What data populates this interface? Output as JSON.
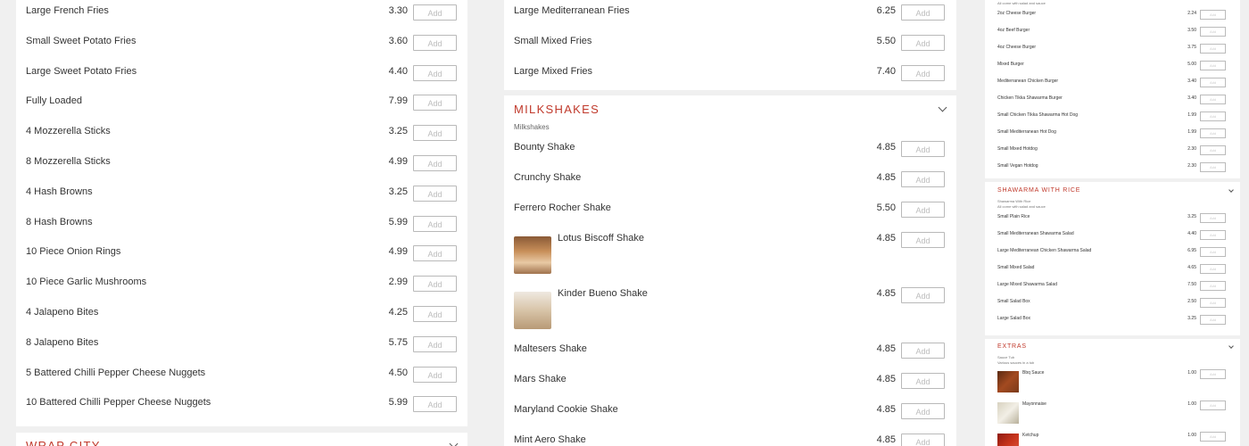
{
  "add_label": "Add",
  "col1": {
    "items": [
      {
        "name": "Large French Fries",
        "price": "3.30"
      },
      {
        "name": "Small Sweet Potato Fries",
        "price": "3.60"
      },
      {
        "name": "Large Sweet Potato Fries",
        "price": "4.40"
      },
      {
        "name": "Fully Loaded",
        "price": "7.99"
      },
      {
        "name": "4 Mozzerella Sticks",
        "price": "3.25"
      },
      {
        "name": "8 Mozzerella Sticks",
        "price": "4.99"
      },
      {
        "name": "4 Hash Browns",
        "price": "3.25"
      },
      {
        "name": "8 Hash Browns",
        "price": "5.99"
      },
      {
        "name": "10 Piece Onion Rings",
        "price": "4.99"
      },
      {
        "name": "10 Piece Garlic Mushrooms",
        "price": "2.99"
      },
      {
        "name": "4 Jalapeno Bites",
        "price": "4.25"
      },
      {
        "name": "8 Jalapeno Bites",
        "price": "5.75"
      },
      {
        "name": "5 Battered Chilli Pepper Cheese Nuggets",
        "price": "4.50"
      },
      {
        "name": "10 Battered Chilli Pepper Cheese Nuggets",
        "price": "5.99"
      }
    ],
    "next_section": "WRAP CITY"
  },
  "col2": {
    "top_items": [
      {
        "name": "Large Mediterranean Fries",
        "price": "6.25"
      },
      {
        "name": "Small Mixed Fries",
        "price": "5.50"
      },
      {
        "name": "Large Mixed Fries",
        "price": "7.40"
      }
    ],
    "section_title": "MILKSHAKES",
    "section_subtitle": "Milkshakes",
    "items": [
      {
        "name": "Bounty Shake",
        "price": "4.85"
      },
      {
        "name": "Crunchy Shake",
        "price": "4.85"
      },
      {
        "name": "Ferrero Rocher Shake",
        "price": "5.50"
      },
      {
        "name": "Lotus Biscoff Shake",
        "price": "4.85"
      },
      {
        "name": "Kinder Bueno Shake",
        "price": "4.85"
      },
      {
        "name": "Maltesers Shake",
        "price": "4.85"
      },
      {
        "name": "Mars Shake",
        "price": "4.85"
      },
      {
        "name": "Maryland Cookie Shake",
        "price": "4.85"
      },
      {
        "name": "Mint Aero Shake",
        "price": "4.85"
      }
    ]
  },
  "col3": {
    "top_note": "All come with salad and sauce",
    "burgers": [
      {
        "name": "2oz Cheese Burger",
        "price": "2.24"
      },
      {
        "name": "4oz Beef Burger",
        "price": "3.50"
      },
      {
        "name": "4oz Cheese Burger",
        "price": "3.75"
      },
      {
        "name": "Mixed Burger",
        "price": "5.00"
      },
      {
        "name": "Mediterranean Chicken Burger",
        "price": "3.40"
      },
      {
        "name": "Chicken Tikka Shawarma Burger",
        "price": "3.40"
      },
      {
        "name": "Small Chicken Tikka Shawarma Hot Dog",
        "price": "1.99"
      },
      {
        "name": "Small Mediterranean Hot Dog",
        "price": "1.99"
      },
      {
        "name": "Small Mixed Hotdog",
        "price": "2.30"
      },
      {
        "name": "Small Vegan Hotdog",
        "price": "2.30"
      }
    ],
    "shawarma_title": "SHAWARMA WITH RICE",
    "shawarma_sub1": "Shawarma With Rice",
    "shawarma_sub2": "All come with salad and sauce",
    "shawarma": [
      {
        "name": "Small Plain Rice",
        "price": "3.25"
      },
      {
        "name": "Small Mediterranean Shawarma Salad",
        "price": "4.40"
      },
      {
        "name": "Large Mediterranean Chicken Shawarma Salad",
        "price": "6.95"
      },
      {
        "name": "Small Mixed Salad",
        "price": "4.65"
      },
      {
        "name": "Large Mixed Shawarma Salad",
        "price": "7.50"
      },
      {
        "name": "Small Salad Box",
        "price": "2.50"
      },
      {
        "name": "Large Salad Box",
        "price": "3.25"
      }
    ],
    "extras_title": "EXTRAS",
    "extras_sub1": "Sauce Tub",
    "extras_sub2": "Various sauces in a tub",
    "extras": [
      {
        "name": "Bbq Sauce",
        "price": "1.00"
      },
      {
        "name": "Mayonnaise",
        "price": "1.00"
      },
      {
        "name": "Ketchup",
        "price": "1.00"
      }
    ]
  }
}
